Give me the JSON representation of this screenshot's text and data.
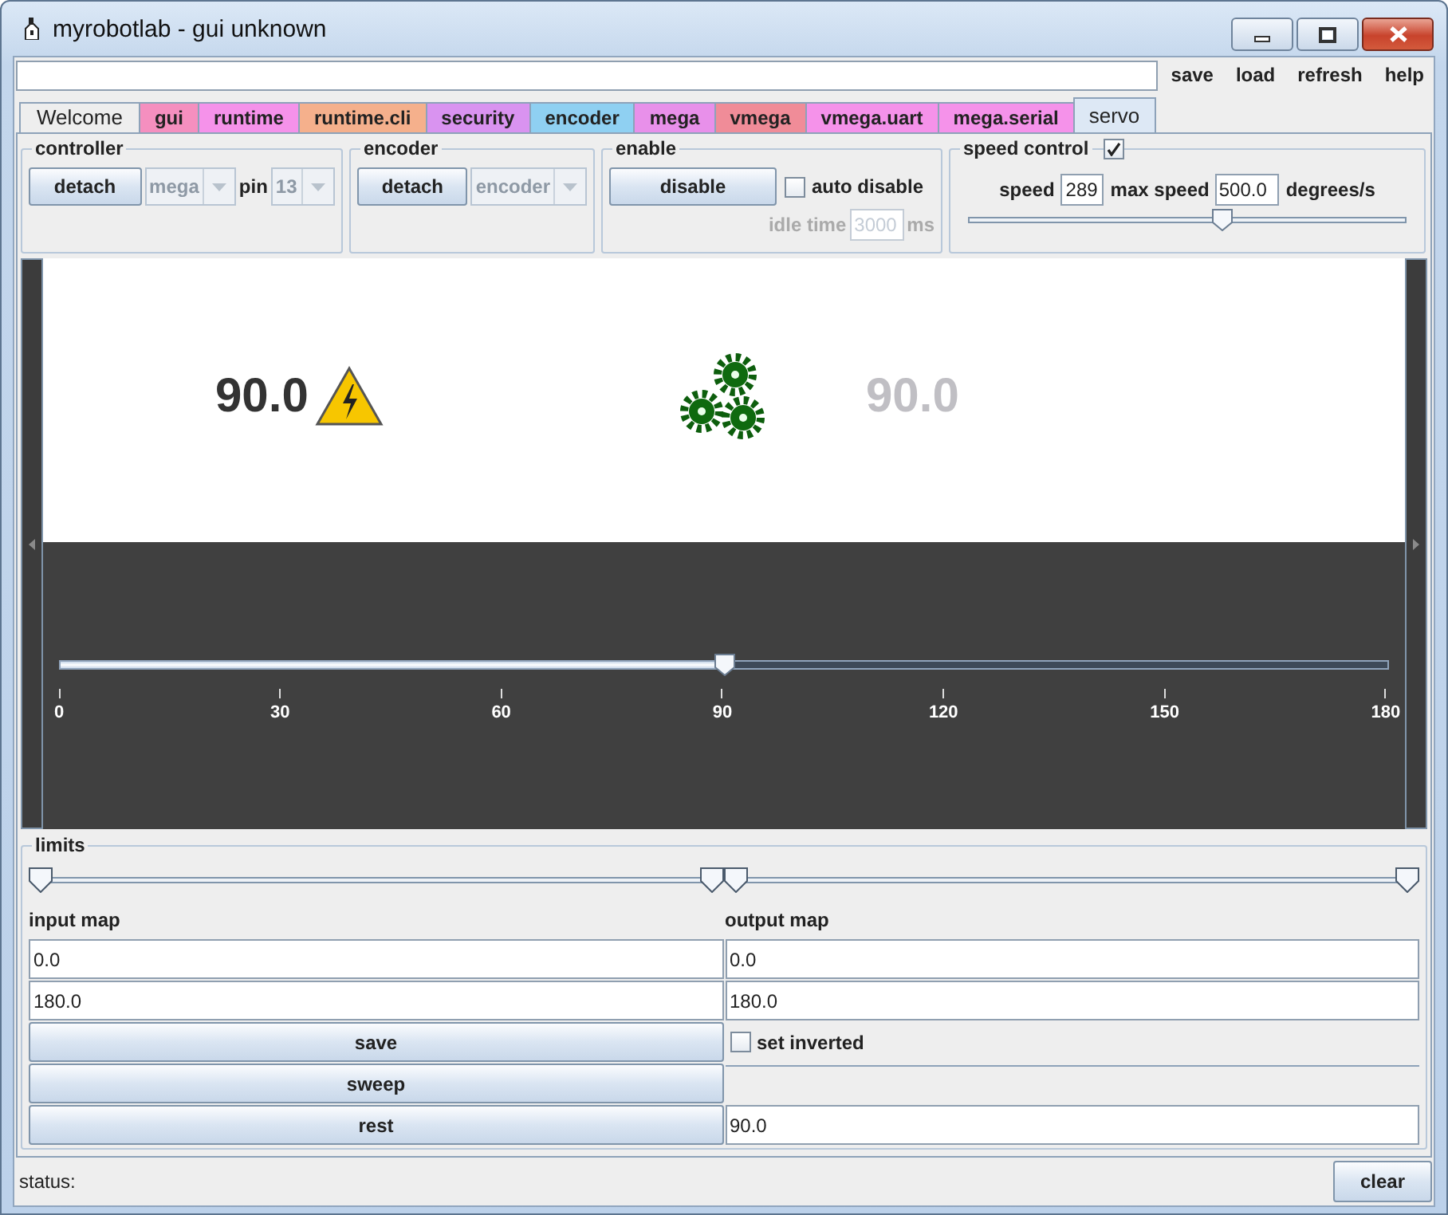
{
  "window": {
    "title": "myrobotlab - gui unknown"
  },
  "menu": {
    "items": [
      "save",
      "load",
      "refresh",
      "help"
    ]
  },
  "tabs": [
    {
      "label": "Welcome",
      "color": "#eeeeee",
      "selected": false
    },
    {
      "label": "gui",
      "color": "#f58fbf",
      "selected": false
    },
    {
      "label": "runtime",
      "color": "#f592ea",
      "selected": false
    },
    {
      "label": "runtime.cli",
      "color": "#f5b08c",
      "selected": false
    },
    {
      "label": "security",
      "color": "#d993f0",
      "selected": false
    },
    {
      "label": "encoder",
      "color": "#8fd0f2",
      "selected": false
    },
    {
      "label": "mega",
      "color": "#e890ea",
      "selected": false
    },
    {
      "label": "vmega",
      "color": "#f08c98",
      "selected": false
    },
    {
      "label": "vmega.uart",
      "color": "#f592ea",
      "selected": false
    },
    {
      "label": "mega.serial",
      "color": "#f592ea",
      "selected": false
    },
    {
      "label": "servo",
      "color": "#dde8f5",
      "selected": true
    }
  ],
  "controller": {
    "title": "controller",
    "button": "detach",
    "dropdown": {
      "value": "mega",
      "disabled": true
    },
    "pin_label": "pin",
    "pin": {
      "value": "13",
      "disabled": true
    }
  },
  "encoder": {
    "title": "encoder",
    "button": "detach",
    "dropdown": {
      "value": "encoder",
      "disabled": true
    }
  },
  "enable": {
    "title": "enable",
    "button": "disable",
    "auto_disable": {
      "label": "auto disable",
      "checked": false
    },
    "idle_label": "idle time",
    "idle_time": {
      "value": "3000",
      "disabled": true
    },
    "idle_unit": "ms"
  },
  "speed_control": {
    "title": "speed control",
    "checked": true,
    "speed_label": "speed",
    "speed": "289",
    "max_label": "max speed",
    "max_speed": "500.0",
    "unit": "degrees/s",
    "level": 0.58
  },
  "display": {
    "current": "90.0",
    "target": "90.0",
    "position": {
      "level": 0.5,
      "ticks": [
        "0",
        "30",
        "60",
        "90",
        "120",
        "150",
        "180"
      ]
    }
  },
  "limits": {
    "title": "limits",
    "input_range": [
      {
        "level": 0
      },
      {
        "level": 1
      }
    ],
    "output_range": [
      {
        "level": 0
      },
      {
        "level": 1
      }
    ],
    "input_label": "input map",
    "input_min": "0.0",
    "input_max": "180.0",
    "output_label": "output map",
    "output_min": "0.0",
    "output_max": "180.0",
    "save": "save",
    "inverted": {
      "label": "set inverted",
      "checked": false
    },
    "sweep": "sweep",
    "rest": "rest",
    "rest_value": "90.0"
  },
  "status_bar": {
    "text": "status:",
    "button": "clear"
  }
}
